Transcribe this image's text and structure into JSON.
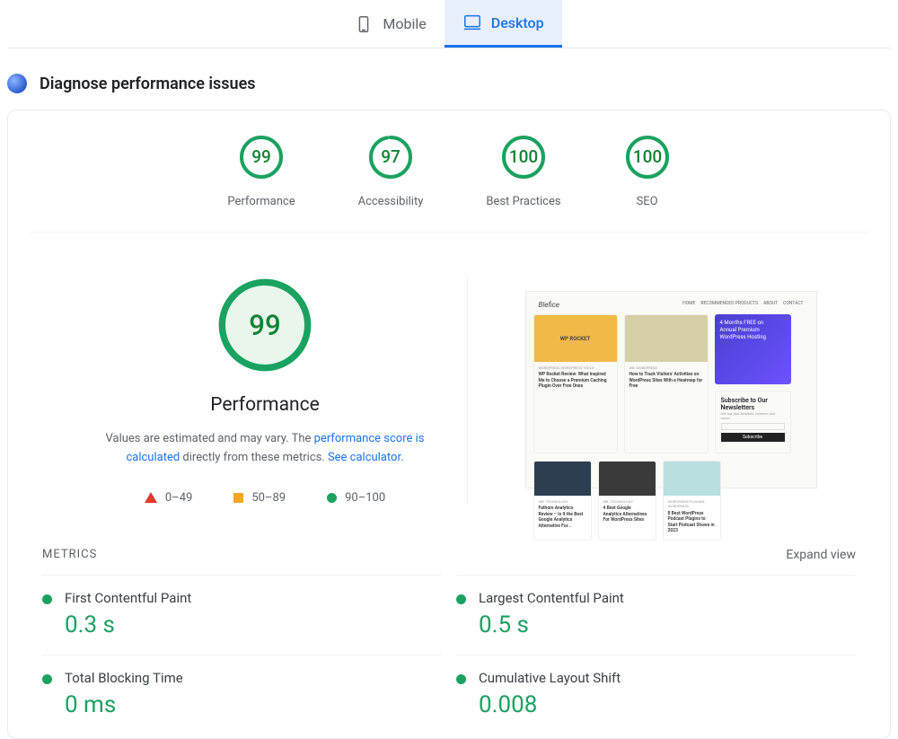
{
  "tabs": {
    "mobile": "Mobile",
    "desktop": "Desktop"
  },
  "section": {
    "title": "Diagnose performance issues"
  },
  "scores": [
    {
      "value": "99",
      "pct": 99,
      "label": "Performance"
    },
    {
      "value": "97",
      "pct": 97,
      "label": "Accessibility"
    },
    {
      "value": "100",
      "pct": 100,
      "label": "Best Practices"
    },
    {
      "value": "100",
      "pct": 100,
      "label": "SEO"
    }
  ],
  "hero": {
    "score": "99",
    "label": "Performance",
    "desc_prefix": "Values are estimated and may vary. The ",
    "link1": "performance score is calculated",
    "desc_mid": " directly from these metrics. ",
    "link2": "See calculator."
  },
  "legend": {
    "bad": "0–49",
    "mid": "50–89",
    "good": "90–100"
  },
  "metrics": {
    "heading": "METRICS",
    "expand": "Expand view",
    "items": [
      {
        "name": "First Contentful Paint",
        "value": "0.3 s"
      },
      {
        "name": "Largest Contentful Paint",
        "value": "0.5 s"
      },
      {
        "name": "Total Blocking Time",
        "value": "0 ms"
      },
      {
        "name": "Cumulative Layout Shift",
        "value": "0.008"
      }
    ]
  },
  "thumb": {
    "brand": "Blefice",
    "nav": [
      "HOME",
      "RECOMMENDED PRODUCTS",
      "ABOUT",
      "CONTACT"
    ],
    "row1": [
      {
        "badge": "WORDPRESS, WORDPRESS TOOLS",
        "title": "WP Rocket Review: What Inspired Me to Choose a Premium Caching Plugin Over Free Ones",
        "bg": "#f0b948",
        "inner": "WP ROCKET"
      },
      {
        "badge": "WB, WORDPRESS",
        "title": "How to Track Visitors' Activities on WordPress Sites With a Heatmap for Free",
        "bg": "#d7cfa8",
        "inner": ""
      }
    ],
    "promo": {
      "l1": "4 Months FREE on",
      "l2": "Annual Premium",
      "l3": "WordPress Hosting"
    },
    "sub": {
      "title": "Subscribe to Our Newsletters",
      "sub": "Get our tips, tutorials, reviews, and more!",
      "btn": "Subscribe"
    },
    "row2": [
      {
        "badge": "WB, TECHNOLOGY",
        "title": "Fathom Analytics Review – Is It the Best Google Analytics Alternative For...",
        "bg": "#2c3e50"
      },
      {
        "badge": "WB, TECHNOLOGY",
        "title": "4 Best Google Analytics Alternatives For WordPress Sites",
        "bg": "#3a3a3a"
      },
      {
        "badge": "WORDPRESS PLUGINS, WORDPRESS",
        "title": "8 Best WordPress Podcast Plugins to Start Podcast Shows in 2023",
        "bg": "#b9dfe0"
      }
    ]
  }
}
